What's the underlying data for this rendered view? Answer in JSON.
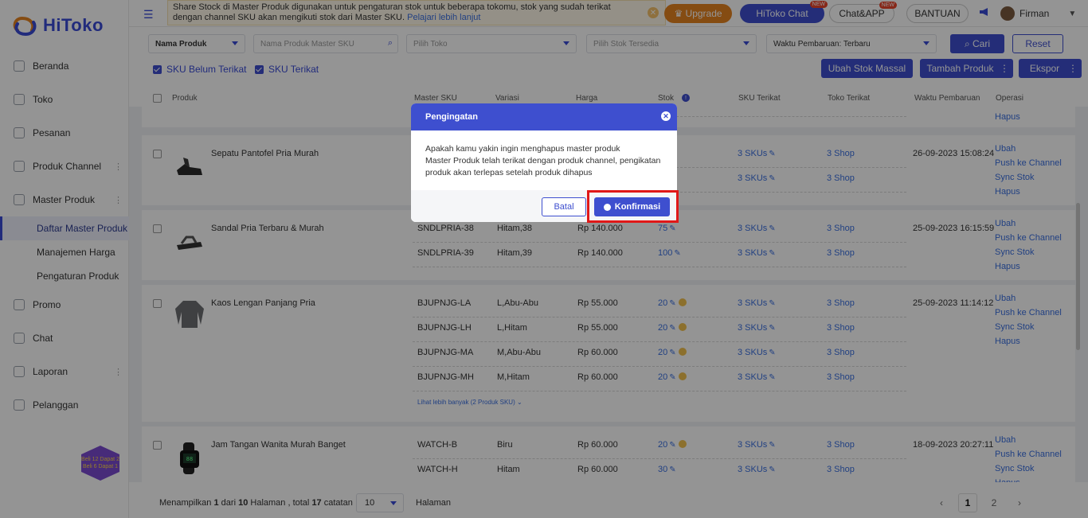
{
  "brand": {
    "name": "HiToko",
    "accent": "#3e4fcf"
  },
  "sidebar": {
    "items": [
      {
        "label": "Beranda",
        "icon": "monitor-icon"
      },
      {
        "label": "Toko",
        "icon": "store-icon"
      },
      {
        "label": "Pesanan",
        "icon": "clipboard-icon"
      },
      {
        "label": "Produk Channel",
        "icon": "grid-icon"
      },
      {
        "label": "Master Produk",
        "icon": "cube-icon"
      }
    ],
    "subitems": [
      "Daftar Master Produk",
      "Manajemen Harga",
      "Pengaturan Produk"
    ],
    "items2": [
      {
        "label": "Promo",
        "icon": "promo-icon"
      },
      {
        "label": "Chat",
        "icon": "chat-icon"
      },
      {
        "label": "Laporan",
        "icon": "report-icon"
      },
      {
        "label": "Pelanggan",
        "icon": "users-icon"
      }
    ],
    "promo_badge": {
      "line1": "Beli",
      "num1": "12",
      "line2": "Dapat",
      "num2": "2",
      "line3": "Beli",
      "num3": "6",
      "line4": "Dapat",
      "num4": "1"
    }
  },
  "topbar": {
    "notice_text": "Share Stock di Master Produk digunakan untuk pengaturan stok untuk beberapa tokomu, stok yang sudah terikat dengan channel SKU akan mengikuti stok dari Master SKU.",
    "notice_link": "Pelajari lebih lanjut",
    "upgrade": "Upgrade",
    "hitoko_chat": "HiToko Chat",
    "chat_app": "Chat&APP",
    "new_tag": "NEW",
    "bantuan": "BANTUAN",
    "user": "Firman"
  },
  "filters": {
    "field_select": "Nama Produk",
    "search_placeholder": "Nama Produk Master SKU",
    "toko_placeholder": "Pilih Toko",
    "stok_placeholder": "Pilih Stok Tersedia",
    "sort": "Waktu Pembaruan: Terbaru",
    "cari": "Cari",
    "reset": "Reset",
    "chk1": "SKU Belum Terikat",
    "chk2": "SKU Terikat",
    "ubah_stok": "Ubah Stok Massal",
    "tambah": "Tambah Produk",
    "ekspor": "Ekspor"
  },
  "columns": [
    "Produk",
    "Master SKU",
    "Variasi",
    "Harga",
    "Stok",
    "SKU Terikat",
    "Toko Terikat",
    "Waktu Pembaruan",
    "Operasi"
  ],
  "products": [
    {
      "name": "Sepatu Pantofel Pria Murah",
      "time": "26-09-2023 15:08:24",
      "rows": [
        {
          "sku": "",
          "var": "",
          "price": "",
          "stock": "",
          "skus": "3 SKUs",
          "shop": "3 Shop"
        },
        {
          "sku": "",
          "var": "",
          "price": "",
          "stock": "",
          "skus": "3 SKUs",
          "shop": "3 Shop"
        }
      ],
      "ops": [
        "Ubah",
        "Push ke Channel",
        "Sync Stok",
        "Hapus"
      ]
    },
    {
      "name": "Sandal Pria Terbaru & Murah",
      "time": "25-09-2023 16:15:59",
      "rows": [
        {
          "sku": "SNDLPRIA-38",
          "var": "Hitam,38",
          "price": "Rp 140.000",
          "stock": "75",
          "skus": "3 SKUs",
          "shop": "3 Shop"
        },
        {
          "sku": "SNDLPRIA-39",
          "var": "Hitam,39",
          "price": "Rp 140.000",
          "stock": "100",
          "skus": "3 SKUs",
          "shop": "3 Shop"
        }
      ],
      "ops": [
        "Ubah",
        "Push ke Channel",
        "Sync Stok",
        "Hapus"
      ]
    },
    {
      "name": "Kaos Lengan Panjang Pria",
      "time": "25-09-2023 11:14:12",
      "rows": [
        {
          "sku": "BJUPNJG-LA",
          "var": "L,Abu-Abu",
          "price": "Rp 55.000",
          "stock": "20",
          "skus": "3 SKUs",
          "shop": "3 Shop"
        },
        {
          "sku": "BJUPNJG-LH",
          "var": "L,Hitam",
          "price": "Rp 55.000",
          "stock": "20",
          "skus": "3 SKUs",
          "shop": "3 Shop"
        },
        {
          "sku": "BJUPNJG-MA",
          "var": "M,Abu-Abu",
          "price": "Rp 60.000",
          "stock": "20",
          "skus": "3 SKUs",
          "shop": "3 Shop"
        },
        {
          "sku": "BJUPNJG-MH",
          "var": "M,Hitam",
          "price": "Rp 60.000",
          "stock": "20",
          "skus": "3 SKUs",
          "shop": "3 Shop"
        }
      ],
      "more": "Lihat lebih banyak (2 Produk SKU)",
      "ops": [
        "Ubah",
        "Push ke Channel",
        "Sync Stok",
        "Hapus"
      ]
    },
    {
      "name": "Jam Tangan Wanita Murah Banget",
      "time": "18-09-2023 20:27:11",
      "rows": [
        {
          "sku": "WATCH-B",
          "var": "Biru",
          "price": "Rp 60.000",
          "stock": "20",
          "skus": "3 SKUs",
          "shop": "3 Shop"
        },
        {
          "sku": "WATCH-H",
          "var": "Hitam",
          "price": "Rp 60.000",
          "stock": "30",
          "skus": "3 SKUs",
          "shop": "3 Shop"
        }
      ],
      "ops": [
        "Ubah",
        "Push ke Channel",
        "Sync Stok",
        "Hapus"
      ]
    }
  ],
  "top_partial_op": "Hapus",
  "pagination": {
    "pre": "Menampilkan",
    "page_current": "1",
    "mid1": "dari",
    "page_total": "10",
    "mid2": "Halaman , total",
    "total_items": "17",
    "post": "catatan",
    "page_size": "10",
    "halaman": "Halaman",
    "pages": [
      "1",
      "2"
    ]
  },
  "modal": {
    "title": "Pengingatan",
    "line1": "Apakah kamu yakin ingin menghapus master produk",
    "line2": "Master Produk telah terikat dengan produk channel, pengikatan produk akan terlepas setelah produk dihapus",
    "cancel": "Batal",
    "confirm": "Konfirmasi"
  }
}
